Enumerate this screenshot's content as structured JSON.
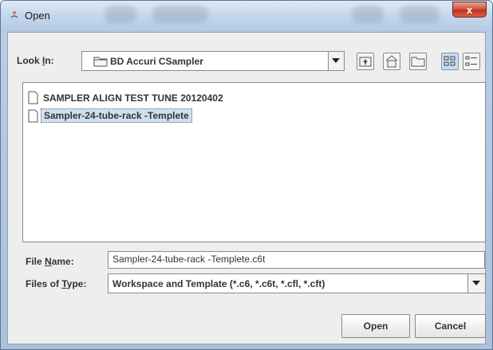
{
  "window": {
    "title": "Open",
    "close_glyph": "x"
  },
  "look_in": {
    "label_prefix": "Look ",
    "label_mnemonic": "I",
    "label_suffix": "n:",
    "value": "BD Accuri CSampler",
    "folder_icon": "folder-icon"
  },
  "toolbar": {
    "buttons": [
      {
        "name": "up-one-level-icon",
        "active": false
      },
      {
        "name": "home-icon",
        "active": false
      },
      {
        "name": "new-folder-icon",
        "active": false
      },
      {
        "name": "list-view-icon",
        "active": true
      },
      {
        "name": "details-view-icon",
        "active": false
      }
    ]
  },
  "files": [
    {
      "name": "SAMPLER ALIGN TEST TUNE 20120402",
      "selected": false,
      "icon": "document-icon"
    },
    {
      "name": "Sampler-24-tube-rack -Templete",
      "selected": true,
      "icon": "document-icon"
    }
  ],
  "file_name": {
    "label_prefix": "File ",
    "label_mnemonic": "N",
    "label_suffix": "ame:",
    "value": "Sampler-24-tube-rack -Templete.c6t"
  },
  "file_type": {
    "label_prefix": "Files of ",
    "label_mnemonic": "T",
    "label_suffix": "ype:",
    "value": "Workspace and Template (*.c6, *.c6t, *.cfl, *.cft)"
  },
  "buttons": {
    "open": "Open",
    "cancel": "Cancel"
  },
  "colors": {
    "selection": "#cfe0f3",
    "close_button": "#c1321c",
    "title_bar": "#c6d8ed"
  }
}
